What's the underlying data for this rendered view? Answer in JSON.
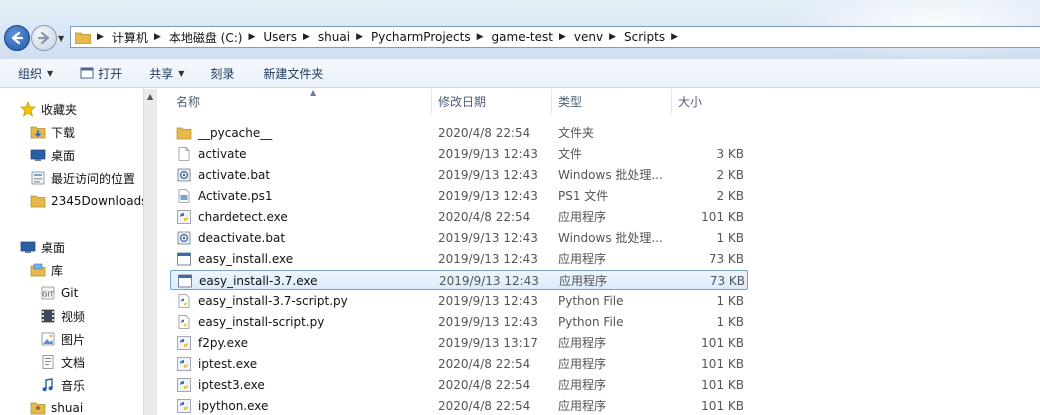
{
  "address": {
    "crumbs": [
      "计算机",
      "本地磁盘 (C:)",
      "Users",
      "shuai",
      "PycharmProjects",
      "game-test",
      "venv",
      "Scripts"
    ]
  },
  "toolbar": {
    "organize": "组织",
    "open": "打开",
    "share": "共享",
    "burn": "刻录",
    "new_folder": "新建文件夹"
  },
  "nav": {
    "favorites": "收藏夹",
    "downloads": "下载",
    "desktop_fav": "桌面",
    "recent": "最近访问的位置",
    "folder_2345": "2345Downloads",
    "desktop": "桌面",
    "libraries": "库",
    "git": "Git",
    "videos": "视频",
    "pictures": "图片",
    "documents": "文档",
    "music": "音乐",
    "user": "shuai"
  },
  "columns": {
    "name": "名称",
    "date": "修改日期",
    "type": "类型",
    "size": "大小"
  },
  "files": [
    {
      "name": "__pycache__",
      "date": "2020/4/8 22:54",
      "type": "文件夹",
      "size": "",
      "icon": "folder-icon"
    },
    {
      "name": "activate",
      "date": "2019/9/13 12:43",
      "type": "文件",
      "size": "3 KB",
      "icon": "file-icon"
    },
    {
      "name": "activate.bat",
      "date": "2019/9/13 12:43",
      "type": "Windows 批处理...",
      "size": "2 KB",
      "icon": "batch-icon"
    },
    {
      "name": "Activate.ps1",
      "date": "2019/9/13 12:43",
      "type": "PS1 文件",
      "size": "2 KB",
      "icon": "ps1-icon"
    },
    {
      "name": "chardetect.exe",
      "date": "2020/4/8 22:54",
      "type": "应用程序",
      "size": "101 KB",
      "icon": "python-exe-icon"
    },
    {
      "name": "deactivate.bat",
      "date": "2019/9/13 12:43",
      "type": "Windows 批处理...",
      "size": "1 KB",
      "icon": "batch-icon"
    },
    {
      "name": "easy_install.exe",
      "date": "2019/9/13 12:43",
      "type": "应用程序",
      "size": "73 KB",
      "icon": "exe-icon"
    },
    {
      "name": "easy_install-3.7.exe",
      "date": "2019/9/13 12:43",
      "type": "应用程序",
      "size": "73 KB",
      "icon": "exe-icon"
    },
    {
      "name": "easy_install-3.7-script.py",
      "date": "2019/9/13 12:43",
      "type": "Python File",
      "size": "1 KB",
      "icon": "python-file-icon"
    },
    {
      "name": "easy_install-script.py",
      "date": "2019/9/13 12:43",
      "type": "Python File",
      "size": "1 KB",
      "icon": "python-file-icon"
    },
    {
      "name": "f2py.exe",
      "date": "2019/9/13 13:17",
      "type": "应用程序",
      "size": "101 KB",
      "icon": "python-exe-icon"
    },
    {
      "name": "iptest.exe",
      "date": "2020/4/8 22:54",
      "type": "应用程序",
      "size": "101 KB",
      "icon": "python-exe-icon"
    },
    {
      "name": "iptest3.exe",
      "date": "2020/4/8 22:54",
      "type": "应用程序",
      "size": "101 KB",
      "icon": "python-exe-icon"
    },
    {
      "name": "ipython.exe",
      "date": "2020/4/8 22:54",
      "type": "应用程序",
      "size": "101 KB",
      "icon": "python-exe-icon"
    }
  ],
  "selected_index": 7
}
